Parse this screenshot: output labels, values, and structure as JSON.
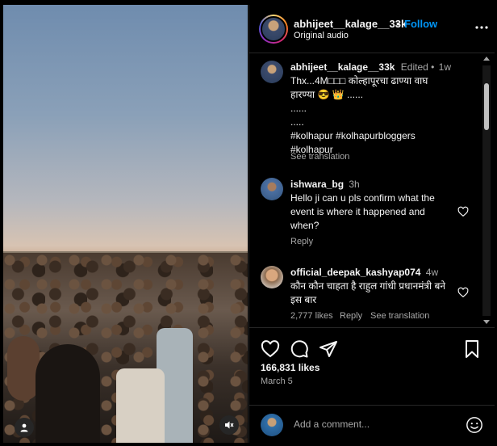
{
  "post": {
    "username": "abhijeet__kalage__33k",
    "separator": "•",
    "follow_label": "Follow",
    "audio": "Original audio"
  },
  "caption": {
    "username": "abhijeet__kalage__33k",
    "edited": "Edited •",
    "time": "1w",
    "lines": [
      "Thx...4M□□□ कोल्हापूरचा ढाण्या वाघ हारण्या 😎 👑 ......",
      "......",
      ".....",
      "#kolhapur #kolhapurbloggers",
      "#kolhapur"
    ],
    "see_translation": "See translation"
  },
  "comments": [
    {
      "username": "ishwara_bg",
      "time": "3h",
      "text": "Hello ji can u pls confirm what the event is where it happened and when?",
      "reply": "Reply"
    },
    {
      "username": "official_deepak_kashyap074",
      "time": "4w",
      "text": "कौन कौन चाहता है राहुल गांधी प्रधानमंत्री बने इस बार",
      "likes": "2,777 likes",
      "reply": "Reply",
      "see_translation": "See translation"
    }
  ],
  "stats": {
    "likes": "166,831 likes",
    "date": "March 5"
  },
  "add_comment": {
    "placeholder": "Add a comment..."
  },
  "colors": {
    "follow": "#0095f6",
    "muted_text": "#a8a8a8",
    "background": "#000000"
  },
  "icons": {
    "like": "heart-icon",
    "comment": "comment-bubble-icon",
    "share": "paper-plane-icon",
    "save": "bookmark-icon",
    "more": "ellipsis-icon",
    "mute": "speaker-muted-icon",
    "tags": "person-icon",
    "emoji": "smiley-icon"
  }
}
